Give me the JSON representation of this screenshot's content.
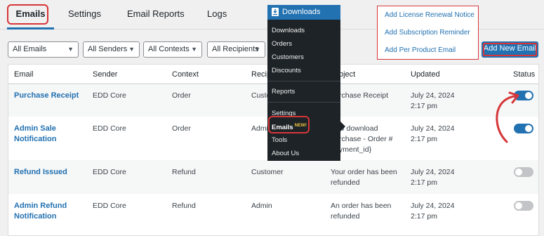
{
  "tabs": [
    {
      "label": "Emails",
      "active": true
    },
    {
      "label": "Settings",
      "active": false
    },
    {
      "label": "Email Reports",
      "active": false
    },
    {
      "label": "Logs",
      "active": false
    }
  ],
  "filters": [
    "All Emails",
    "All Senders",
    "All Contexts",
    "All Recipients"
  ],
  "add_new_label": "Add New Email",
  "dropdown_items": [
    "Add License Renewal Notice",
    "Add Subscription Reminder",
    "Add Per Product Email"
  ],
  "table": {
    "headers": [
      "Email",
      "Sender",
      "Context",
      "Recipi",
      "bject",
      "Updated",
      "Status"
    ],
    "rows": [
      {
        "email": [
          "Purchase Receipt"
        ],
        "sender": "EDD Core",
        "context": "Order",
        "recipient": "Custo",
        "subject": [
          "rchase Receipt"
        ],
        "updated": [
          "July 24, 2024",
          "2:17 pm"
        ],
        "status": "on"
      },
      {
        "email": [
          "Admin Sale",
          "Notification"
        ],
        "sender": "EDD Core",
        "context": "Order",
        "recipient": "Admi",
        "subject": [
          "w download",
          "rchase - Order #",
          "yment_id}"
        ],
        "updated": [
          "July 24, 2024",
          "2:17 pm"
        ],
        "status": "on"
      },
      {
        "email": [
          "Refund Issued"
        ],
        "sender": "EDD Core",
        "context": "Refund",
        "recipient": "Customer",
        "subject": [
          "Your order has been",
          "refunded"
        ],
        "updated": [
          "July 24, 2024",
          "2:17 pm"
        ],
        "status": "off"
      },
      {
        "email": [
          "Admin Refund",
          "Notification"
        ],
        "sender": "EDD Core",
        "context": "Refund",
        "recipient": "Admin",
        "subject": [
          "An order has been",
          "refunded"
        ],
        "updated": [
          "July 24, 2024",
          "2:17 pm"
        ],
        "status": "off"
      }
    ]
  },
  "menu": {
    "title": "Downloads",
    "items": [
      "Downloads",
      "Orders",
      "Customers",
      "Discounts",
      "Reports",
      "Settings",
      "Emails",
      "Tools",
      "About Us"
    ],
    "new_badge": "NEW!"
  },
  "colors": {
    "accent": "#2271b1",
    "highlight": "#d63638",
    "menu_bg": "#1d2327"
  }
}
